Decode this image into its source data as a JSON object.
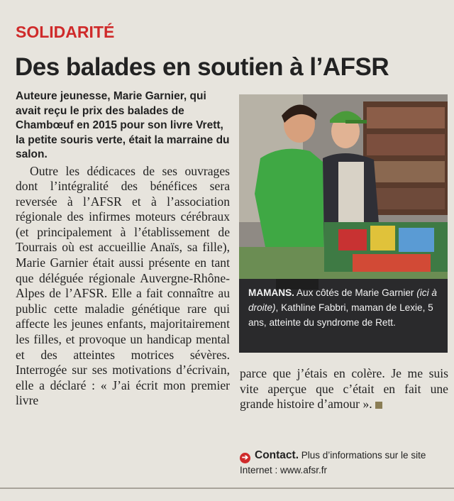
{
  "article": {
    "rubric": "SOLIDARITÉ",
    "headline": "Des balades en soutien à l’AFSR",
    "chapo": "Auteure jeunesse, Marie Garnier, qui avait reçu le prix des balades de Chambœuf en 2015 pour son livre Vrett, la petite souris verte, était la marraine du salon.",
    "body_left": "Outre les dédicaces de ses ouvrages dont l’intégralité des bénéfices sera reversée à l’AFSR et à l’association régionale des infirmes moteurs cérébraux (et principalement à l’établissement de Tourrais où est accueillie Anaïs, sa fille), Marie Garnier était aussi présente en tant que déléguée régionale Auvergne-Rhône-Alpes de l’AFSR. Elle a fait connaître au public cette maladie génétique rare qui affecte les jeunes enfants, majoritairement les filles, et provoque un handicap mental et des atteintes motrices sévères. Interrogée sur ses motivations d’écrivain, elle a déclaré : « J’ai écrit mon premier livre",
    "body_right": "parce que j’étais en colère. Je me suis vite aperçue que c’était en fait une grande histoire d’amour »."
  },
  "photo": {
    "subject": "two women standing behind a book stand",
    "caption_lead": "MAMANS.",
    "caption_part1": " Aux côtés de Marie Garnier ",
    "caption_paren": "(ici à droite)",
    "caption_part2": ", Kathline Fabbri, maman de Lexie, 5 ans, atteinte du syndrome de Rett.",
    "colors": {
      "shirt": "#3fa844",
      "cap": "#4a9a3a",
      "background": "#2a2a2c"
    }
  },
  "contact": {
    "label": "Contact.",
    "text": " Plus d’informations sur le site Internet : www.afsr.fr",
    "icon": "arrow-right-icon"
  },
  "colors": {
    "accent": "#cf2a2a",
    "text": "#222222",
    "paper": "#e7e4dd"
  }
}
